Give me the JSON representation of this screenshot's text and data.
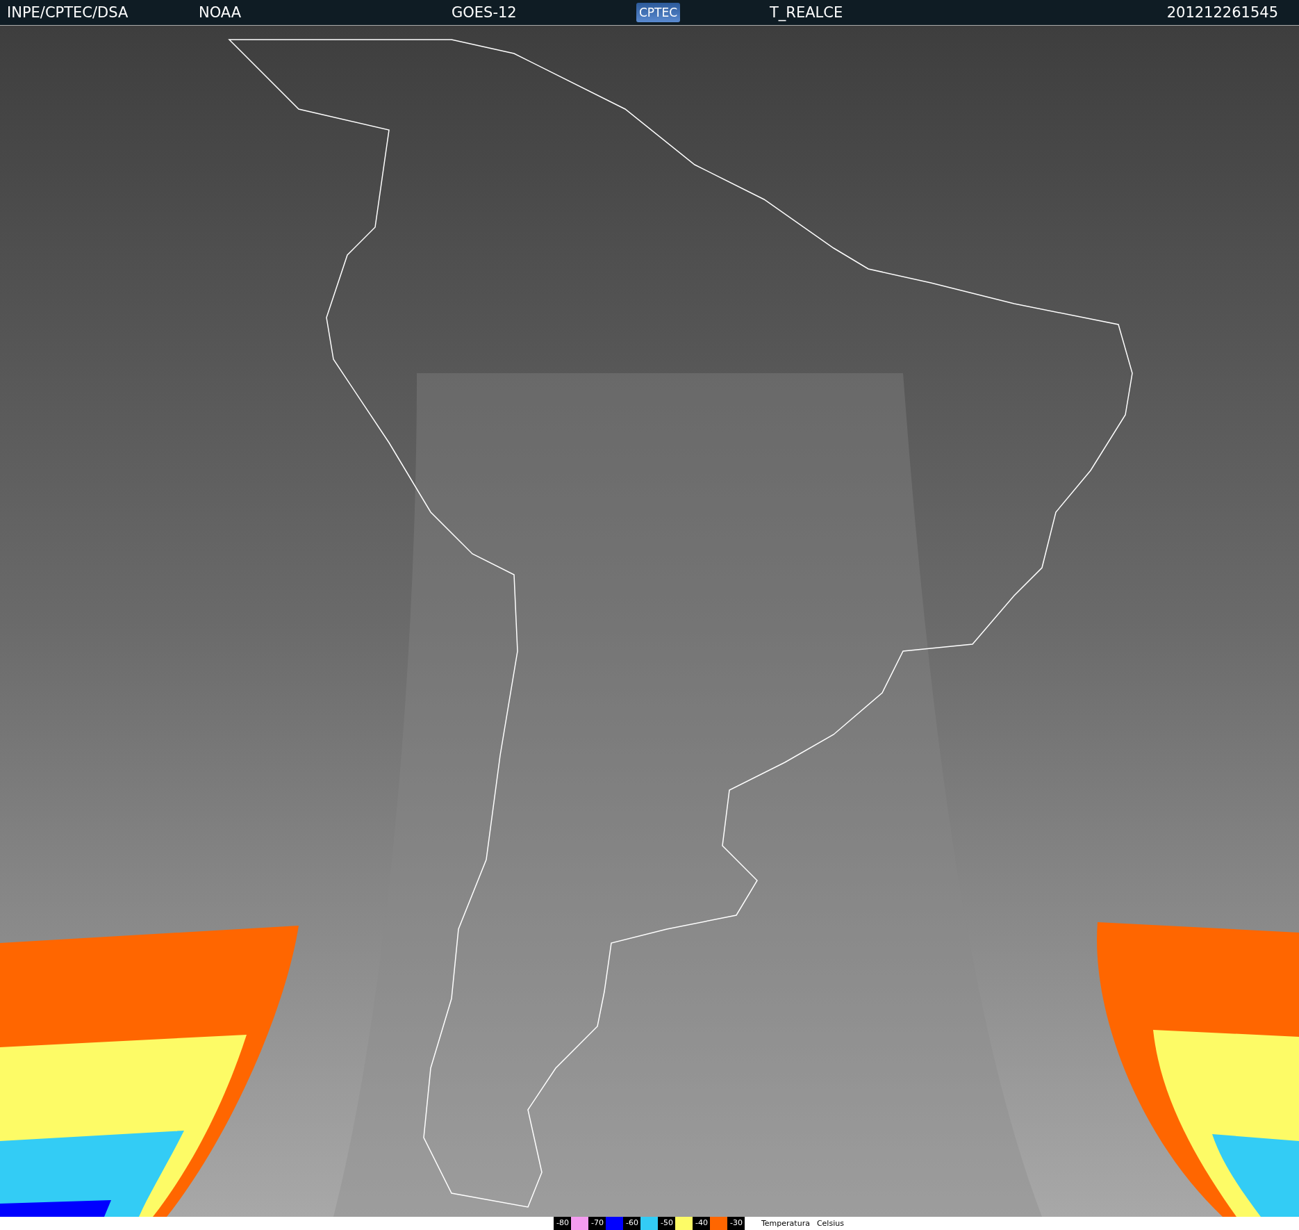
{
  "header": {
    "source": "INPE/CPTEC/DSA",
    "agency": "NOAA",
    "satellite": "GOES-12",
    "logo": "CPTEC",
    "product": "T_REALCE",
    "timestamp": "201212261545"
  },
  "legend": {
    "items": [
      {
        "label": "-80",
        "color": "#f59cf0"
      },
      {
        "label": "-70",
        "color": "#0000ff"
      },
      {
        "label": "-60",
        "color": "#33ccf5"
      },
      {
        "label": "-50",
        "color": "#fdfb66"
      },
      {
        "label": "-40",
        "color": "#ff6600"
      },
      {
        "label": "-30"
      }
    ],
    "caption": [
      "Temperatura",
      "Celsius"
    ]
  }
}
